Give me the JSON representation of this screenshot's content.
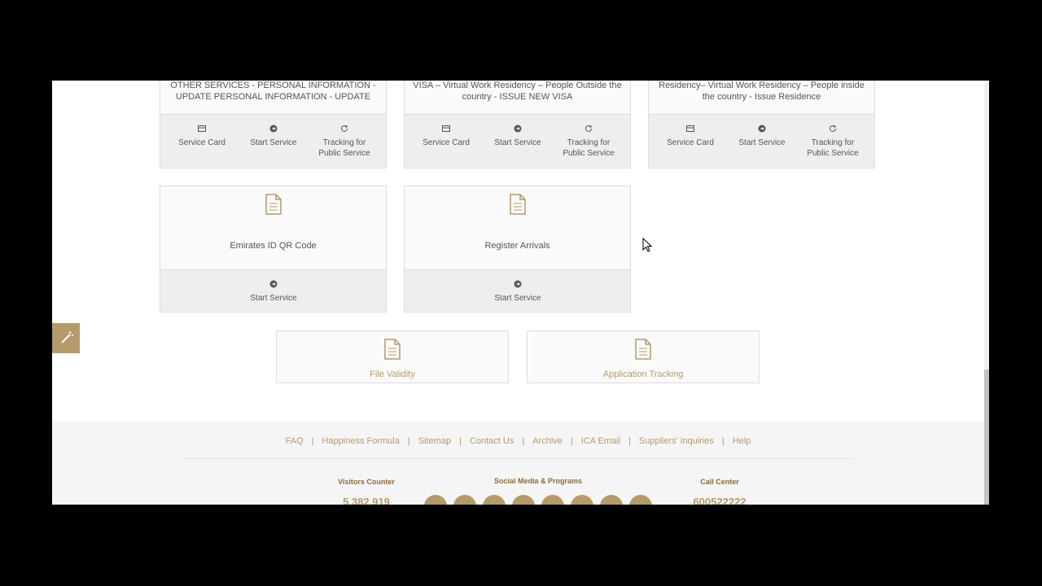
{
  "cards_row1": [
    {
      "title": "OTHER SERVICES - PERSONAL INFORMATION - UPDATE PERSONAL INFORMATION - UPDATE",
      "actions": [
        "Service Card",
        "Start Service",
        "Tracking for Public Service"
      ]
    },
    {
      "title": "VISA – Virtual Work Residency – People Outside the country - ISSUE NEW VISA",
      "actions": [
        "Service Card",
        "Start Service",
        "Tracking for Public Service"
      ]
    },
    {
      "title": "Residency– Virtual Work Residency – People inside the country - Issue Residence",
      "actions": [
        "Service Card",
        "Start Service",
        "Tracking for Public Service"
      ]
    }
  ],
  "cards_row2": [
    {
      "title": "Emirates ID QR Code",
      "action": "Start Service"
    },
    {
      "title": "Register Arrivals",
      "action": "Start Service"
    }
  ],
  "cards_row3": [
    {
      "title": "File Validity"
    },
    {
      "title": "Application Tracking"
    }
  ],
  "footer": {
    "links": [
      "FAQ",
      "Happiness Formula",
      "Sitemap",
      "Contact Us",
      "Archive",
      "ICA Email",
      "Suppliers' inquiries",
      "Help"
    ],
    "visitors_label": "Visitors Counter",
    "visitors_value": "5,382,919",
    "social_label": "Social Media & Programs",
    "callcenter_label": "Call Center",
    "callcenter_value": "600522222"
  },
  "colors": {
    "accent": "#b59a6a"
  }
}
